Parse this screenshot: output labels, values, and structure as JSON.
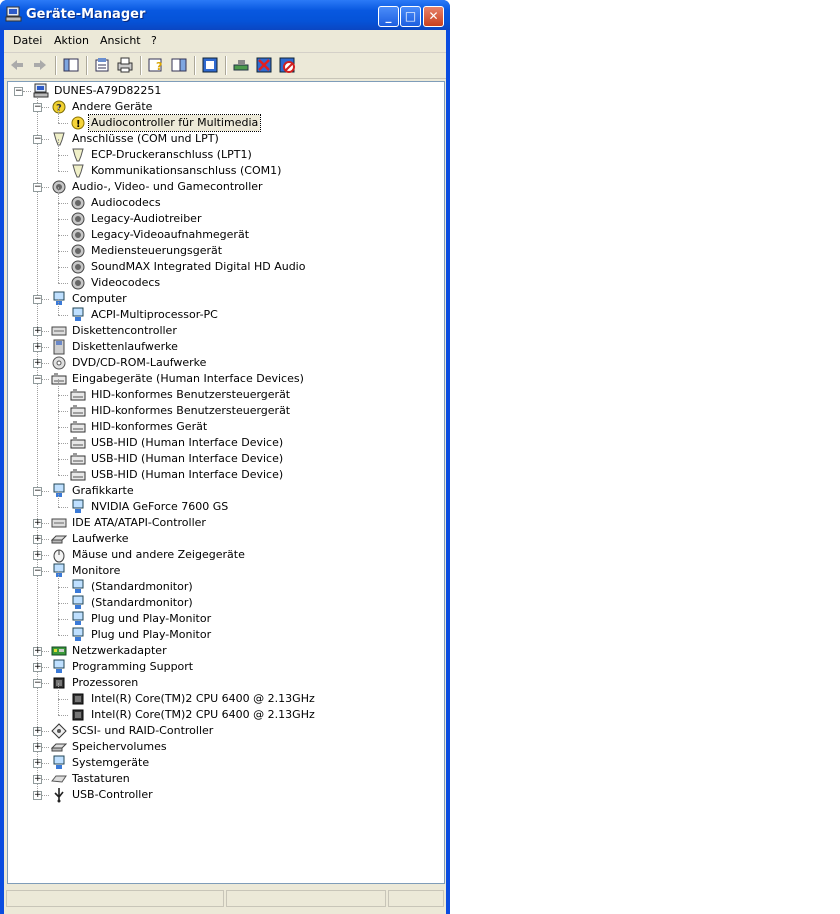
{
  "window": {
    "title": "Geräte-Manager"
  },
  "menu": [
    "Datei",
    "Aktion",
    "Ansicht",
    "?"
  ],
  "toolbar_icons": [
    "back-icon",
    "forward-icon",
    "up-icon",
    "properties-icon",
    "print-icon",
    "help-icon",
    "show-hide-tree-icon",
    "update-driver-icon",
    "scan-hardware-icon",
    "uninstall-icon",
    "disable-icon"
  ],
  "tree": {
    "root": "DUNES-A79D82251",
    "nodes": [
      {
        "label": "Andere Geräte",
        "level": 1,
        "expanded": true,
        "icon": "question-icon"
      },
      {
        "label": "Audiocontroller für Multimedia",
        "level": 2,
        "icon": "warning-icon",
        "selected": true
      },
      {
        "label": "Anschlüsse (COM und LPT)",
        "level": 1,
        "expanded": true,
        "icon": "port-icon"
      },
      {
        "label": "ECP-Druckeranschluss (LPT1)",
        "level": 2,
        "icon": "port-icon"
      },
      {
        "label": "Kommunikationsanschluss (COM1)",
        "level": 2,
        "icon": "port-icon"
      },
      {
        "label": "Audio-, Video- und Gamecontroller",
        "level": 1,
        "expanded": true,
        "icon": "speaker-icon"
      },
      {
        "label": "Audiocodecs",
        "level": 2,
        "icon": "speaker-icon"
      },
      {
        "label": "Legacy-Audiotreiber",
        "level": 2,
        "icon": "speaker-icon"
      },
      {
        "label": "Legacy-Videoaufnahmegerät",
        "level": 2,
        "icon": "speaker-icon"
      },
      {
        "label": "Mediensteuerungsgerät",
        "level": 2,
        "icon": "speaker-icon"
      },
      {
        "label": "SoundMAX Integrated Digital HD Audio",
        "level": 2,
        "icon": "speaker-icon"
      },
      {
        "label": "Videocodecs",
        "level": 2,
        "icon": "speaker-icon"
      },
      {
        "label": "Computer",
        "level": 1,
        "expanded": true,
        "icon": "computer-icon"
      },
      {
        "label": "ACPI-Multiprocessor-PC",
        "level": 2,
        "icon": "computer-icon"
      },
      {
        "label": "Diskettencontroller",
        "level": 1,
        "expanded": false,
        "icon": "controller-icon"
      },
      {
        "label": "Diskettenlaufwerke",
        "level": 1,
        "expanded": false,
        "icon": "floppy-icon"
      },
      {
        "label": "DVD/CD-ROM-Laufwerke",
        "level": 1,
        "expanded": false,
        "icon": "cdrom-icon"
      },
      {
        "label": "Eingabegeräte (Human Interface Devices)",
        "level": 1,
        "expanded": true,
        "icon": "hid-icon"
      },
      {
        "label": "HID-konformes Benutzersteuergerät",
        "level": 2,
        "icon": "hid-icon"
      },
      {
        "label": "HID-konformes Benutzersteuergerät",
        "level": 2,
        "icon": "hid-icon"
      },
      {
        "label": "HID-konformes Gerät",
        "level": 2,
        "icon": "hid-icon"
      },
      {
        "label": "USB-HID (Human Interface Device)",
        "level": 2,
        "icon": "hid-icon"
      },
      {
        "label": "USB-HID (Human Interface Device)",
        "level": 2,
        "icon": "hid-icon"
      },
      {
        "label": "USB-HID (Human Interface Device)",
        "level": 2,
        "icon": "hid-icon"
      },
      {
        "label": "Grafikkarte",
        "level": 1,
        "expanded": true,
        "icon": "monitor-icon"
      },
      {
        "label": "NVIDIA GeForce 7600 GS",
        "level": 2,
        "icon": "monitor-icon"
      },
      {
        "label": "IDE ATA/ATAPI-Controller",
        "level": 1,
        "expanded": false,
        "icon": "controller-icon"
      },
      {
        "label": "Laufwerke",
        "level": 1,
        "expanded": false,
        "icon": "drive-icon"
      },
      {
        "label": "Mäuse und andere Zeigegeräte",
        "level": 1,
        "expanded": false,
        "icon": "mouse-icon"
      },
      {
        "label": "Monitore",
        "level": 1,
        "expanded": true,
        "icon": "monitor-icon"
      },
      {
        "label": "(Standardmonitor)",
        "level": 2,
        "icon": "monitor-icon"
      },
      {
        "label": "(Standardmonitor)",
        "level": 2,
        "icon": "monitor-icon"
      },
      {
        "label": "Plug und Play-Monitor",
        "level": 2,
        "icon": "monitor-icon"
      },
      {
        "label": "Plug und Play-Monitor",
        "level": 2,
        "icon": "monitor-icon"
      },
      {
        "label": "Netzwerkadapter",
        "level": 1,
        "expanded": false,
        "icon": "network-icon"
      },
      {
        "label": "Programming Support",
        "level": 1,
        "expanded": false,
        "icon": "monitor-icon"
      },
      {
        "label": "Prozessoren",
        "level": 1,
        "expanded": true,
        "icon": "chip-icon"
      },
      {
        "label": "Intel(R) Core(TM)2 CPU          6400  @ 2.13GHz",
        "level": 2,
        "icon": "chip-icon"
      },
      {
        "label": "Intel(R) Core(TM)2 CPU          6400  @ 2.13GHz",
        "level": 2,
        "icon": "chip-icon"
      },
      {
        "label": "SCSI- und RAID-Controller",
        "level": 1,
        "expanded": false,
        "icon": "scsi-icon"
      },
      {
        "label": "Speichervolumes",
        "level": 1,
        "expanded": false,
        "icon": "drive-icon"
      },
      {
        "label": "Systemgeräte",
        "level": 1,
        "expanded": false,
        "icon": "monitor-icon"
      },
      {
        "label": "Tastaturen",
        "level": 1,
        "expanded": false,
        "icon": "keyboard-icon"
      },
      {
        "label": "USB-Controller",
        "level": 1,
        "expanded": false,
        "icon": "usb-icon"
      }
    ]
  }
}
